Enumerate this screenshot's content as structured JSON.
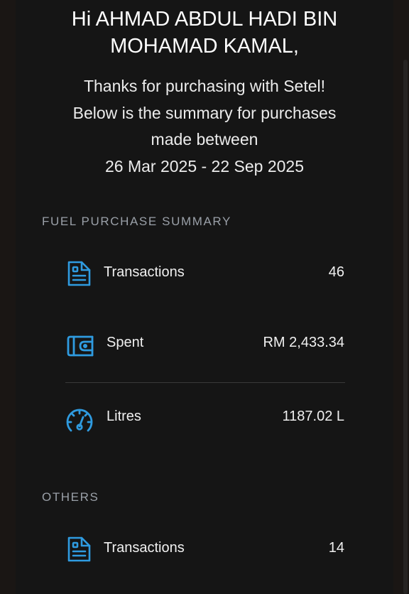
{
  "greeting": {
    "line1": "Hi AHMAD ABDUL HADI BIN",
    "line2": "MOHAMAD KAMAL,"
  },
  "intro": {
    "line1": "Thanks for purchasing with Setel!",
    "line2": "Below is the summary for purchases",
    "line3": "made between",
    "date_range": "26 Mar 2025 - 22 Sep 2025"
  },
  "fuel_summary": {
    "title": "FUEL PURCHASE SUMMARY",
    "transactions": {
      "label": "Transactions",
      "value": "46",
      "icon": "document-icon"
    },
    "spent": {
      "label": "Spent",
      "value": "RM 2,433.34",
      "icon": "wallet-icon"
    },
    "litres": {
      "label": "Litres",
      "value": "1187.02 L",
      "icon": "fuel-gauge-icon"
    }
  },
  "others": {
    "title": "OTHERS",
    "transactions": {
      "label": "Transactions",
      "value": "14",
      "icon": "document-icon"
    }
  },
  "colors": {
    "accent_icon": "#2f9be0",
    "background": "#151515",
    "text": "#f0f0f0",
    "section_title": "#9aa0a8"
  }
}
